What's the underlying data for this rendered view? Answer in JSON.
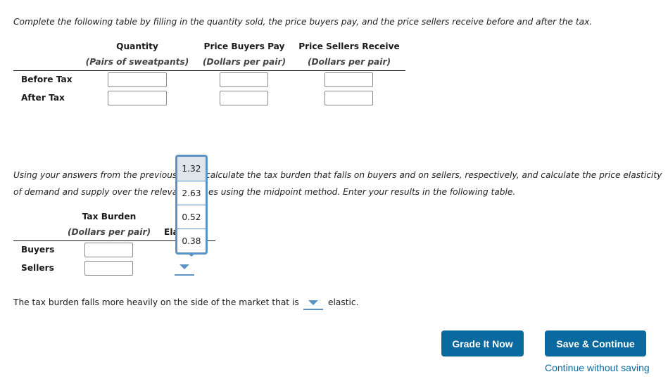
{
  "instructions_1": "Complete the following table by filling in the quantity sold, the price buyers pay, and the price sellers receive before and after the tax.",
  "table1": {
    "columns": [
      {
        "header": "Quantity",
        "subheader": "(Pairs of sweatpants)"
      },
      {
        "header": "Price Buyers Pay",
        "subheader": "(Dollars per pair)"
      },
      {
        "header": "Price Sellers Receive",
        "subheader": "(Dollars per pair)"
      }
    ],
    "rows": [
      {
        "label": "Before Tax",
        "values": [
          "",
          "",
          ""
        ]
      },
      {
        "label": "After Tax",
        "values": [
          "",
          "",
          ""
        ]
      }
    ]
  },
  "instructions_2": {
    "line1_left": "Using your answers from the previous",
    "line1_right": "calculate the tax burden that falls on buyers and on sellers, respectively, and calculate the price elasticity",
    "line2_left": "of demand and supply over the releva",
    "line2_right": "es using the midpoint method. Enter your results in the following table."
  },
  "table2": {
    "columns": [
      {
        "header": "Tax Burden",
        "subheader": "(Dollars per pair)"
      },
      {
        "header": "",
        "subheader": "Ela"
      }
    ],
    "rows": [
      {
        "label": "Buyers",
        "value": ""
      },
      {
        "label": "Sellers",
        "value": ""
      }
    ]
  },
  "elasticity_dropdown": {
    "options": [
      "1.32",
      "2.63",
      "0.52",
      "0.38"
    ],
    "highlighted": "1.32",
    "selected": ""
  },
  "sentence": {
    "before": "The tax burden falls more heavily on the side of the market that is",
    "selected": "",
    "after": "elastic."
  },
  "buttons": {
    "grade": "Grade It Now",
    "save": "Save & Continue",
    "continue_link": "Continue without saving"
  },
  "colors": {
    "button_bg": "#0a6aa0",
    "dropdown_accent": "#5b93c7",
    "highlight": "#dfe6ea"
  }
}
